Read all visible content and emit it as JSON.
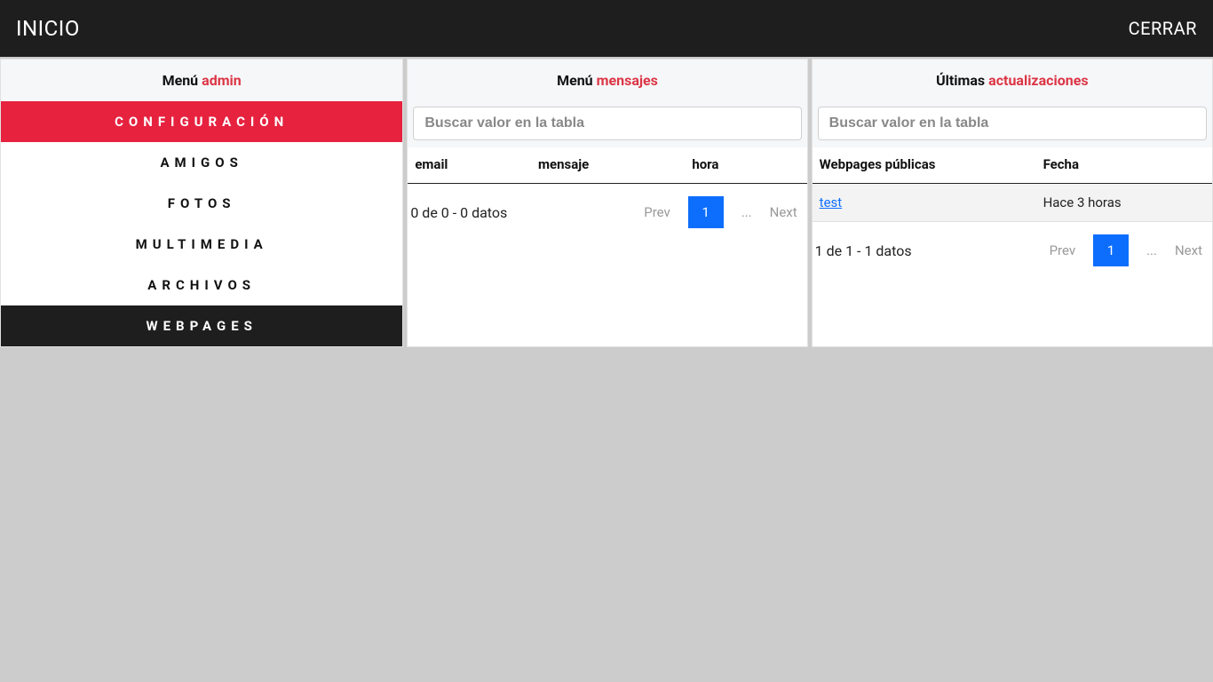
{
  "topbar": {
    "home": "INICIO",
    "close": "CERRAR"
  },
  "sidebar": {
    "title_prefix": "Menú ",
    "title_accent": "admin",
    "items": [
      {
        "label": "CONFIGURACIÓN",
        "state": "active"
      },
      {
        "label": "AMIGOS",
        "state": ""
      },
      {
        "label": "FOTOS",
        "state": ""
      },
      {
        "label": "MULTIMEDIA",
        "state": ""
      },
      {
        "label": "ARCHIVOS",
        "state": ""
      },
      {
        "label": "WEBPAGES",
        "state": "dark"
      }
    ]
  },
  "messages": {
    "title_prefix": "Menú ",
    "title_accent": "mensajes",
    "search_placeholder": "Buscar valor en la tabla",
    "cols": {
      "email": "email",
      "mensaje": "mensaje",
      "hora": "hora"
    },
    "count_text": "0 de 0 - 0 datos",
    "pager": {
      "prev": "Prev",
      "current": "1",
      "ellipsis": "...",
      "next": "Next"
    }
  },
  "updates": {
    "title_prefix": "Últimas ",
    "title_accent": "actualizaciones",
    "search_placeholder": "Buscar valor en la tabla",
    "cols": {
      "webpages": "Webpages públicas",
      "fecha": "Fecha"
    },
    "rows": [
      {
        "name": "test",
        "fecha": "Hace 3 horas"
      }
    ],
    "count_text": "1 de 1 - 1 datos",
    "pager": {
      "prev": "Prev",
      "current": "1",
      "ellipsis": "...",
      "next": "Next"
    }
  }
}
